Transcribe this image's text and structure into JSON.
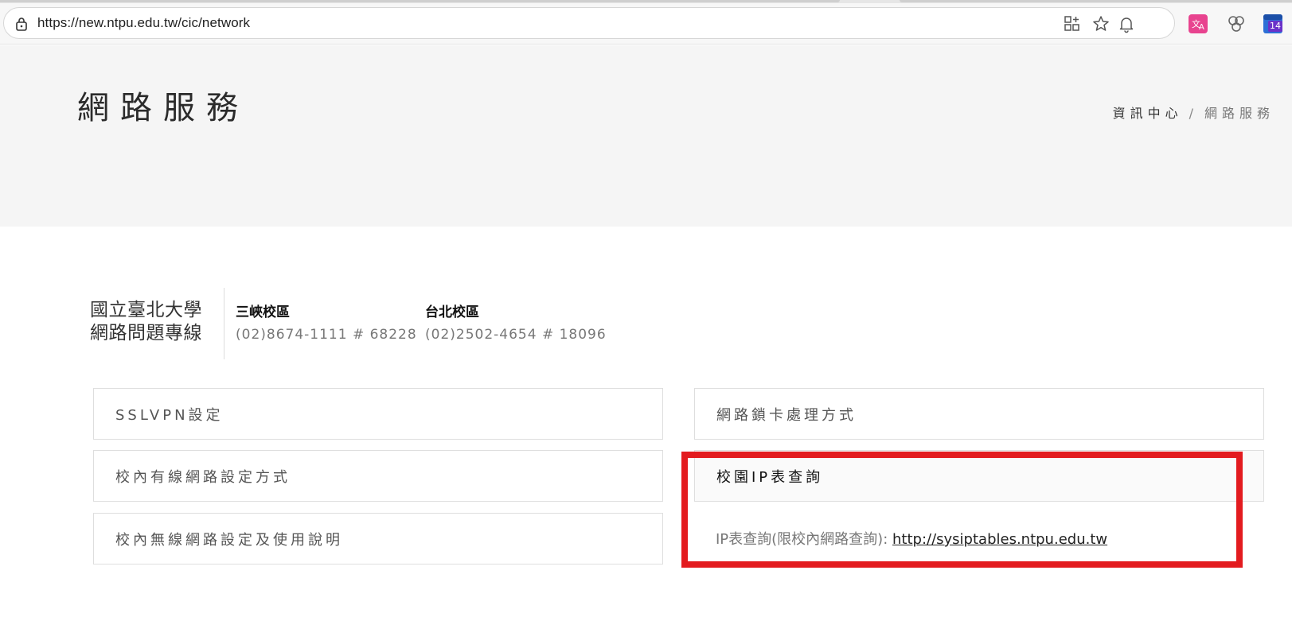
{
  "browser": {
    "url": "https://new.ntpu.edu.tw/cic/network",
    "badge_count": "14"
  },
  "hero": {
    "title": "網路服務",
    "breadcrumb": [
      "資訊中心",
      "網路服務"
    ],
    "breadcrumb_sep": "/"
  },
  "hotline": {
    "title_line1": "國立臺北大學",
    "title_line2": "網路問題專線",
    "campuses": [
      {
        "name": "三峽校區",
        "phone": "(02)8674-1111 # 68228"
      },
      {
        "name": "台北校區",
        "phone": "(02)2502-4654 # 18096"
      }
    ]
  },
  "left_items": [
    "SSLVPN設定",
    "校內有線網路設定方式",
    "校內無線網路設定及使用說明"
  ],
  "right_items": [
    "網路鎖卡處理方式",
    "校園IP表查詢"
  ],
  "ip_panel": {
    "label": "IP表查詢(限校內網路查詢): ",
    "link": "http://sysiptables.ntpu.edu.tw"
  },
  "colors": {
    "highlight": "#e31b1f",
    "hero_bg": "#f5f5f5"
  }
}
